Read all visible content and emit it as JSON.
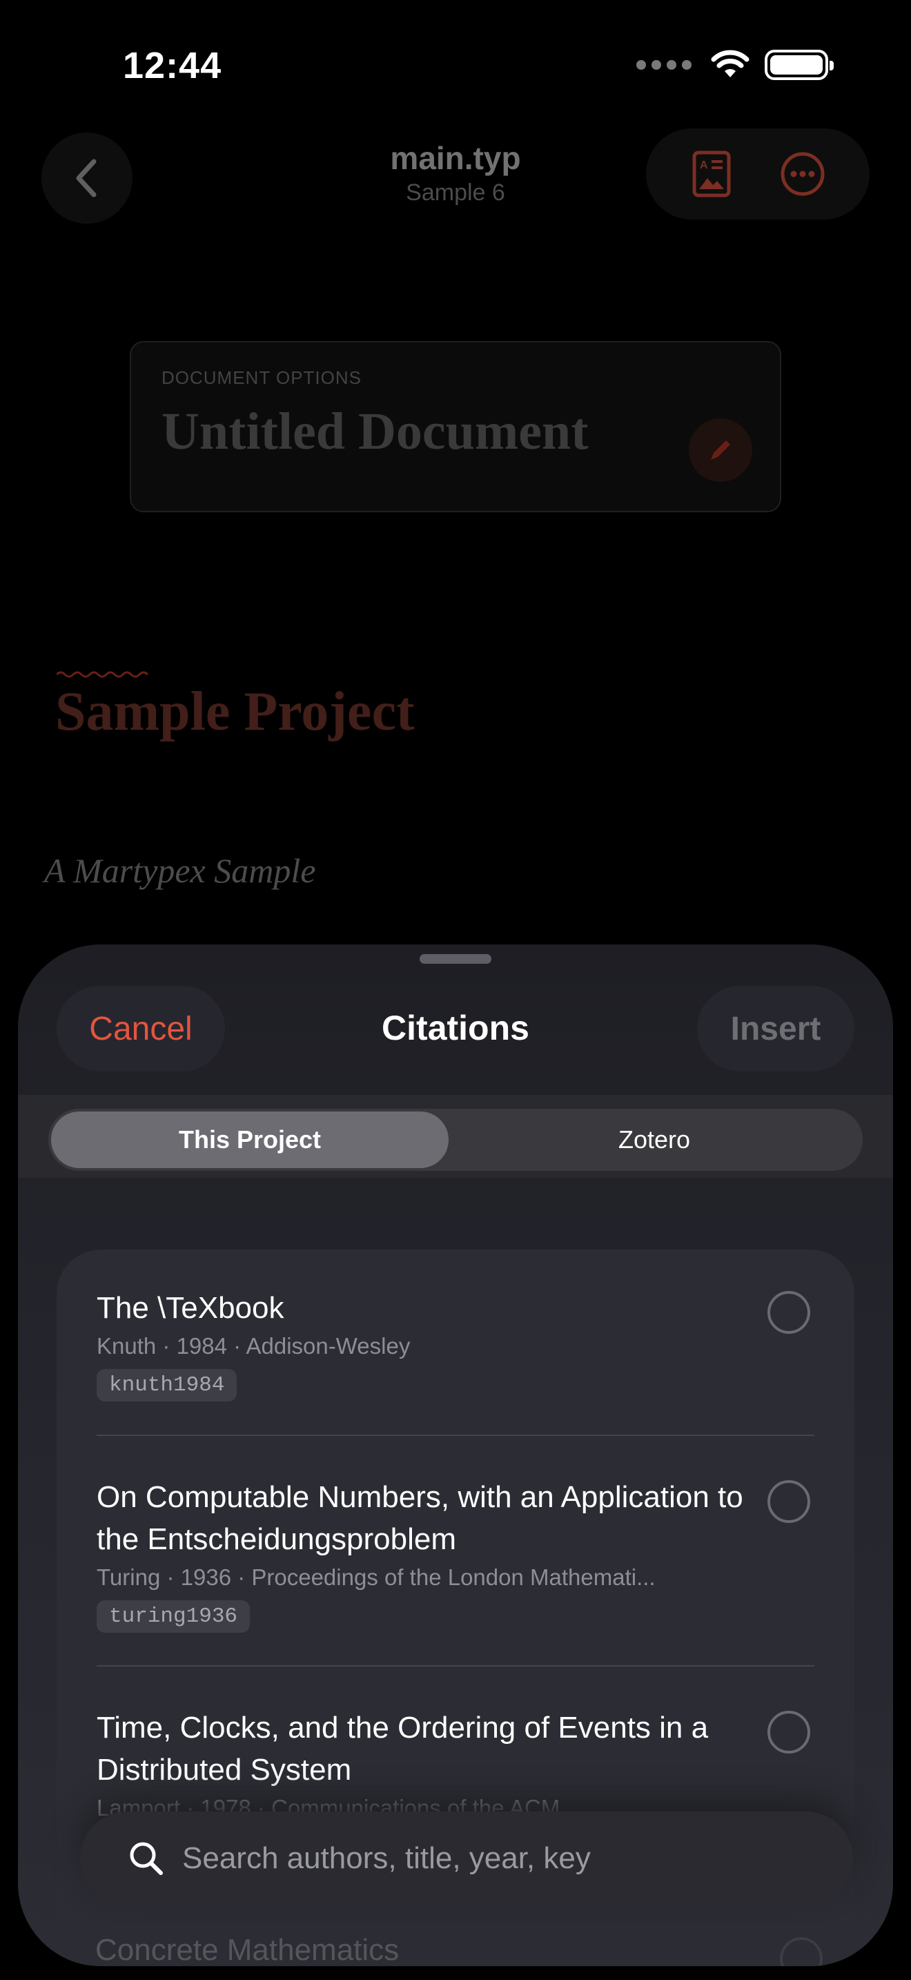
{
  "status_bar": {
    "time": "12:44"
  },
  "nav": {
    "title": "main.typ",
    "subtitle": "Sample 6"
  },
  "document": {
    "options_label": "DOCUMENT OPTIONS",
    "doc_title": "Untitled Document",
    "project_title": "Sample Project",
    "project_subtitle": "A Martypex Sample"
  },
  "sheet": {
    "cancel_label": "Cancel",
    "title": "Citations",
    "insert_label": "Insert",
    "segments": [
      "This Project",
      "Zotero"
    ],
    "selected_segment": "This Project",
    "citations": [
      {
        "title": "The \\TeXbook",
        "meta": "Knuth · 1984 · Addison-Wesley",
        "key": "knuth1984"
      },
      {
        "title": "On Computable Numbers, with an Application to the Entscheidungsproblem",
        "meta": "Turing · 1936 · Proceedings of the London Mathemati...",
        "key": "turing1936"
      },
      {
        "title": "Time, Clocks, and the Ordering of Events in a Distributed System",
        "meta": "Lamport · 1978 · Communications of the ACM",
        "key": ""
      },
      {
        "title": "Concrete Mathematics",
        "meta": "",
        "key": ""
      }
    ],
    "search_placeholder": "Search authors, title, year, key"
  },
  "colors": {
    "accent": "#e2553f",
    "sheet_bg": "#24242c",
    "card_bg": "#2c2c34"
  }
}
